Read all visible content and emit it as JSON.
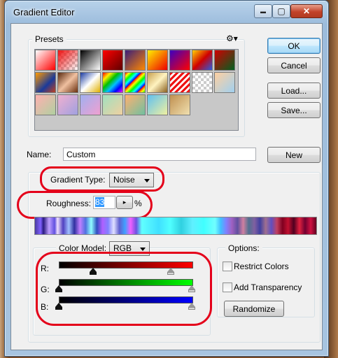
{
  "window": {
    "title": "Gradient Editor",
    "min_glyph": "▬",
    "max_glyph": "▢",
    "close_glyph": "✕"
  },
  "presets": {
    "label": "Presets",
    "menu_glyph": "⚙▾"
  },
  "buttons": {
    "ok": "OK",
    "cancel": "Cancel",
    "load": "Load...",
    "save": "Save...",
    "new": "New",
    "randomize": "Randomize"
  },
  "name": {
    "label": "Name:",
    "value": "Custom"
  },
  "gradient_type": {
    "label": "Gradient Type:",
    "value": "Noise"
  },
  "roughness": {
    "label": "Roughness:",
    "value": "83",
    "unit": "%",
    "stepper_glyph": "▸"
  },
  "color_model": {
    "label": "Color Model:",
    "value": "RGB"
  },
  "sliders": {
    "r": {
      "label": "R:",
      "from": "#000000",
      "to": "#ff0000",
      "low": 0.26,
      "high": 0.84
    },
    "g": {
      "label": "G:",
      "from": "#000000",
      "to": "#00ff00",
      "low": 0.0,
      "high": 1.0
    },
    "b": {
      "label": "B:",
      "from": "#000000",
      "to": "#0000ff",
      "low": 0.0,
      "high": 1.0
    }
  },
  "options": {
    "label": "Options:",
    "restrict_colors": "Restrict Colors",
    "add_transparency": "Add Transparency"
  },
  "colors": {
    "accent_red": "#e4001a",
    "title_blue": "#9cbcdc"
  }
}
